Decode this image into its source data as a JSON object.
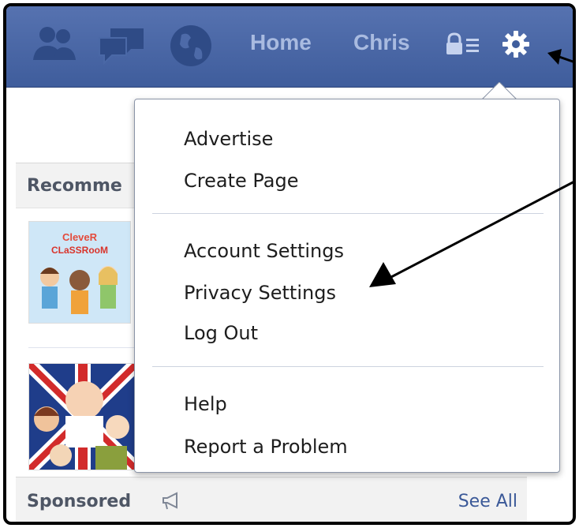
{
  "nav": {
    "home_label": "Home",
    "profile_label": "Chris",
    "icons": [
      "friend-requests-icon",
      "messages-icon",
      "notifications-globe-icon",
      "privacy-shortcuts-icon",
      "gear-icon"
    ]
  },
  "sidebar": {
    "recommended_header": "Recomme",
    "sponsored_label": "Sponsored",
    "see_all_label": "See All",
    "thumb1_title": "CleveR CLaSSRooM",
    "thumb_names": [
      "clever-classroom-thumb",
      "family-guy-thumb"
    ]
  },
  "menu": {
    "groups": [
      [
        "Advertise",
        "Create Page"
      ],
      [
        "Account Settings",
        "Privacy Settings",
        "Log Out"
      ],
      [
        "Help",
        "Report a Problem"
      ]
    ]
  },
  "colors": {
    "topbar": "#3f5d9c",
    "nav_text": "#a9bbe0",
    "link": "#3b5998",
    "menu_text": "#1d1d1d"
  }
}
